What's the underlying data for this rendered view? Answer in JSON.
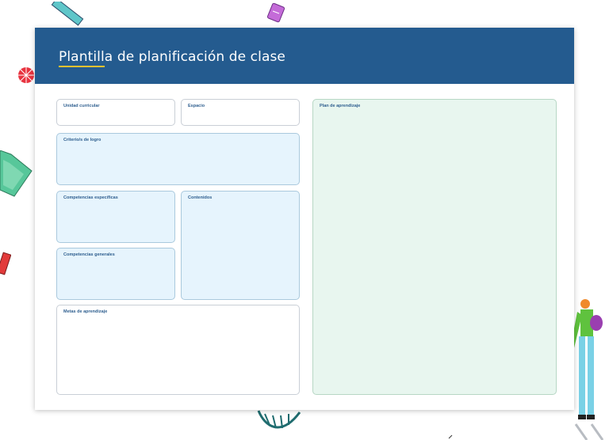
{
  "page": {
    "title": "Plantilla de planificación de clase"
  },
  "sections": {
    "unidad": "Unidad curricular",
    "espacio": "Espacio",
    "criterio": "Criterio/s de logro",
    "competencias_especificas": "Competencias específicas",
    "contenidos": "Contenidos",
    "competencias_generales": "Competencias generales",
    "metas": "Metas de aprendizaje",
    "plan": "Plan de aprendizaje"
  },
  "colors": {
    "header": "#245b8f",
    "accent": "#f2c230",
    "blue_box": "#e6f4fd",
    "green_box": "#e8f6ef"
  },
  "decorations": [
    "ruler-icon",
    "notebook-icon",
    "coral-icon",
    "laptop-icon",
    "red-book-icon",
    "leaf-icon",
    "person-illustration"
  ]
}
